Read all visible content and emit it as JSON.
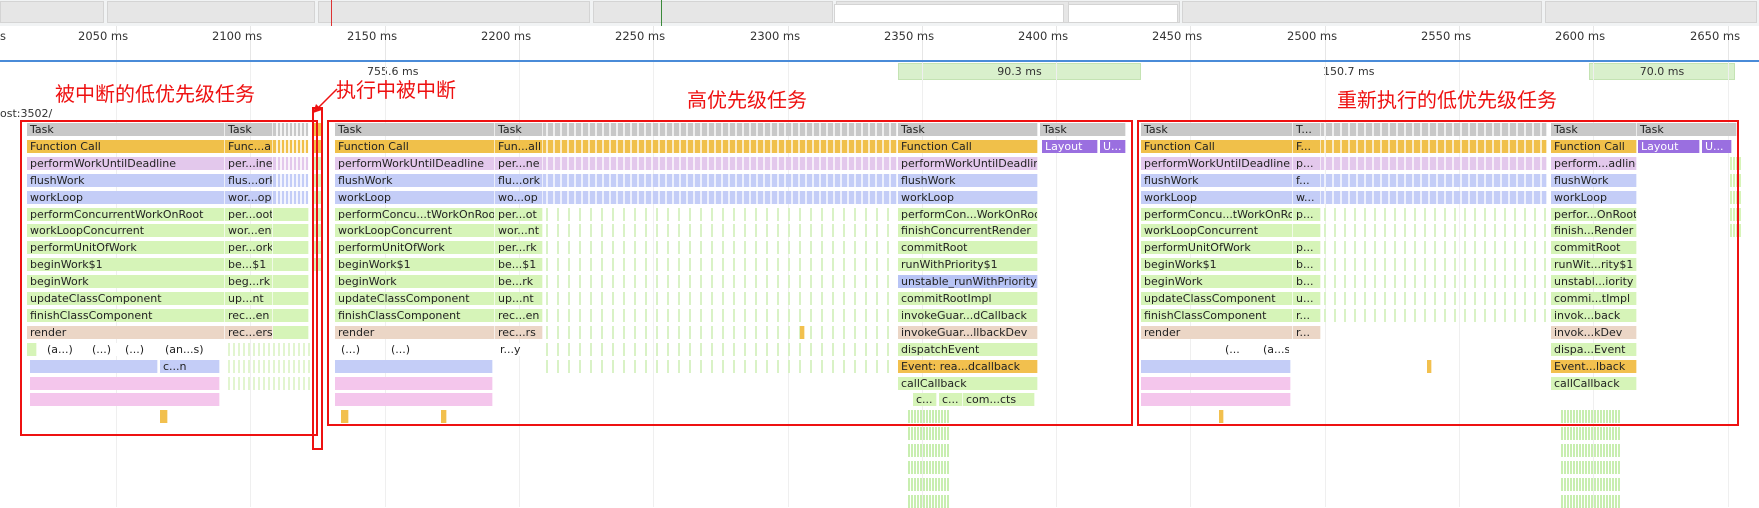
{
  "ruler": {
    "ticks": [
      "2050 ms",
      "2100 ms",
      "2150 ms",
      "2200 ms",
      "2250 ms",
      "2300 ms",
      "2350 ms",
      "2400 ms",
      "2450 ms",
      "2500 ms",
      "2550 ms",
      "2600 ms",
      "2650 ms"
    ]
  },
  "frames": {
    "durations": [
      "755.6 ms",
      "90.3 ms",
      "150.7 ms",
      "70.0 ms"
    ]
  },
  "thread_label": "ost:3502/",
  "annotations": {
    "interrupted_low": "被中断的低优先级任务",
    "interrupted_during": "执行中被中断",
    "high_priority": "高优先级任务",
    "re_executed_low": "重新执行的低优先级任务"
  },
  "colors": {
    "task": "#c8c8c8",
    "function_call": "#f0c04a",
    "perform_work": "#e3c8ec",
    "blue": "#c4cdf7",
    "green": "#d6f4b8",
    "render": "#ebd6c6",
    "layout": "#9a6fe0",
    "yellow": "#f2c04e",
    "pink": "#f4c6ec",
    "unstable": "#b8c4f5",
    "annotation": "#ee1111"
  },
  "flame": {
    "g1": {
      "col1": [
        "Task",
        "Function Call",
        "performWorkUntilDeadline",
        "flushWork",
        "workLoop",
        "performConcurrentWorkOnRoot",
        "workLoopConcurrent",
        "performUnitOfWork",
        "beginWork$1",
        "beginWork",
        "updateClassComponent",
        "finishClassComponent",
        "render"
      ],
      "col2": [
        "Task",
        "Func...all",
        "per...ine",
        "flus...ork",
        "wor...op",
        "per...oot",
        "wor...ent",
        "per...ork",
        "be...$1",
        "beg...rk",
        "up...nt",
        "rec...en",
        "rec...ers"
      ],
      "small": [
        "(a...)",
        "(...)",
        "(...)",
        "(an...s)",
        "c...n"
      ]
    },
    "g2": {
      "col1": [
        "Task",
        "Function Call",
        "performWorkUntilDeadline",
        "flushWork",
        "workLoop",
        "performConcu...tWorkOnRoot",
        "workLoopConcurrent",
        "performUnitOfWork",
        "beginWork$1",
        "beginWork",
        "updateClassComponent",
        "finishClassComponent",
        "render"
      ],
      "col2": [
        "Task",
        "Fun...all",
        "per...ne",
        "flu...ork",
        "wo...op",
        "per...ot",
        "wor...nt",
        "per...rk",
        "be...$1",
        "be...rk",
        "up...nt",
        "rec...en",
        "rec...rs"
      ],
      "small": [
        "(...)",
        "(...)",
        "r...y"
      ]
    },
    "g3": {
      "col": [
        "Task",
        "Function Call",
        "performWorkUntilDeadline",
        "flushWork",
        "workLoop",
        "performCon...WorkOnRoot",
        "finishConcurrentRender",
        "commitRoot",
        "runWithPriority$1",
        "unstable_runWithPriority",
        "commitRootImpl",
        "invokeGuar...dCallback",
        "invokeGuar...llbackDev",
        "dispatchEvent",
        "Event: rea...dcallback",
        "callCallback"
      ],
      "small": [
        "c...",
        "c...",
        "com...cts"
      ]
    },
    "g4": {
      "task": "Task",
      "layout": "Layout",
      "u": "U..."
    },
    "g5": {
      "col1": [
        "Task",
        "Function Call",
        "performWorkUntilDeadline",
        "flushWork",
        "workLoop",
        "performConcu...tWorkOnRoot",
        "workLoopConcurrent",
        "performUnitOfWork",
        "beginWork$1",
        "beginWork",
        "updateClassComponent",
        "finishClassComponent",
        "render"
      ],
      "col2": [
        "T...",
        "F...",
        "p...",
        "f...",
        "w...",
        "p...",
        "",
        "p...",
        "b...",
        "b...",
        "u...",
        "r...",
        "r..."
      ],
      "small": [
        "(...",
        "(a...s)"
      ]
    },
    "g6": {
      "col": [
        "Task",
        "Function Call",
        "perform...adline",
        "flushWork",
        "workLoop",
        "perfor...OnRoot",
        "finish...Render",
        "commitRoot",
        "runWit...rity$1",
        "unstabl...iority",
        "commi...tImpl",
        "invok...back",
        "invok...kDev",
        "dispa...Event",
        "Event...lback",
        "callCallback"
      ]
    },
    "g7": {
      "task": "Task",
      "layout": "Layout",
      "u": "U..."
    }
  }
}
